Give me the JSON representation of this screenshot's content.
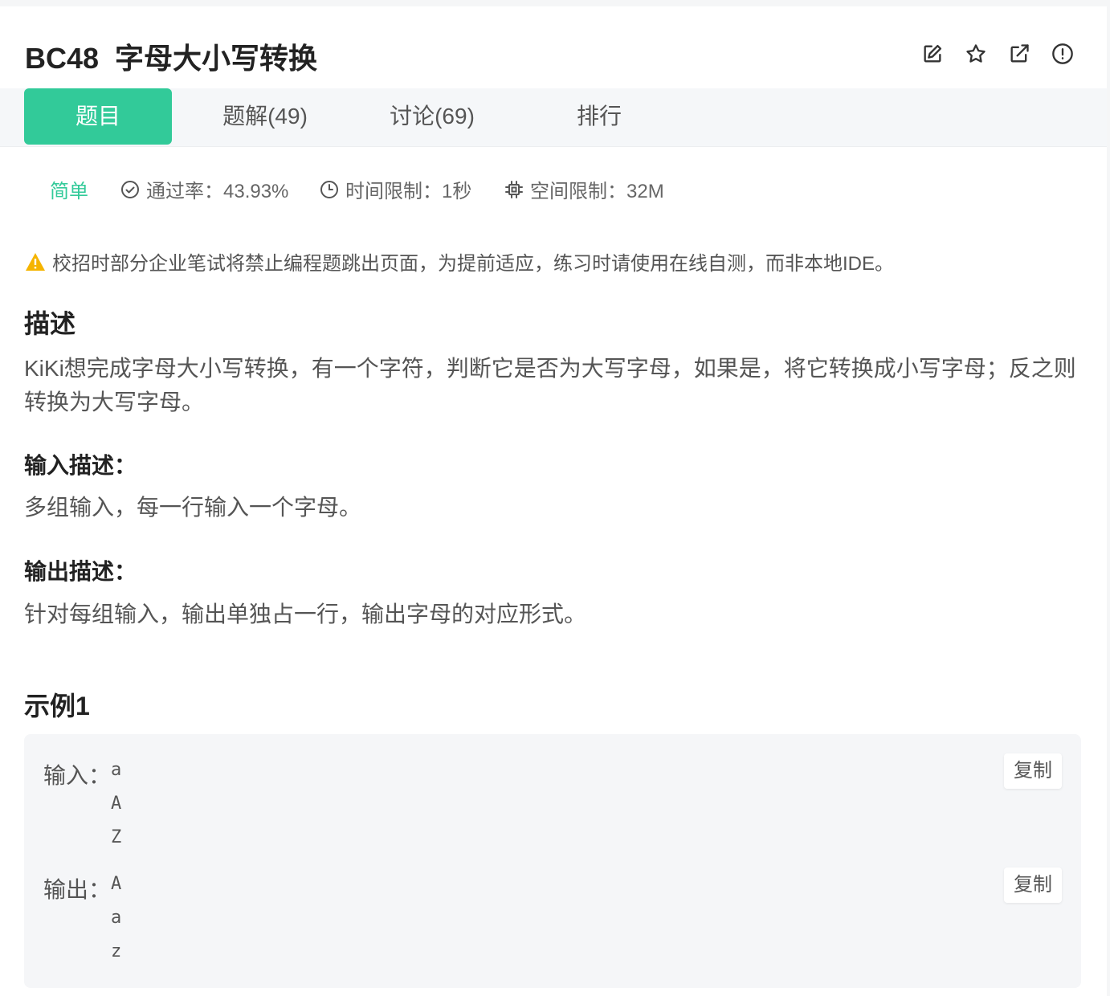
{
  "problem": {
    "id": "BC48",
    "title": "字母大小写转换"
  },
  "header_icons": [
    "edit-icon",
    "star-icon",
    "share-icon",
    "report-icon"
  ],
  "tabs": [
    {
      "label": "题目",
      "active": true
    },
    {
      "label": "题解(49)",
      "active": false
    },
    {
      "label": "讨论(69)",
      "active": false
    },
    {
      "label": "排行",
      "active": false
    }
  ],
  "meta": {
    "difficulty": "简单",
    "pass_rate": "通过率：43.93%",
    "time_limit": "时间限制：1秒",
    "memory_limit": "空间限制：32M"
  },
  "notice": "校招时部分企业笔试将禁止编程题跳出页面，为提前适应，练习时请使用在线自测，而非本地IDE。",
  "description": {
    "heading": "描述",
    "text": "KiKi想完成字母大小写转换，有一个字符，判断它是否为大写字母，如果是，将它转换成小写字母；反之则转换为大写字母。"
  },
  "input_desc": {
    "heading": "输入描述：",
    "text": "多组输入，每一行输入一个字母。"
  },
  "output_desc": {
    "heading": "输出描述：",
    "text": "针对每组输入，输出单独占一行，输出字母的对应形式。"
  },
  "example": {
    "heading": "示例1",
    "input_label": "输入：",
    "input_lines": [
      "a",
      "A",
      "Z"
    ],
    "output_label": "输出：",
    "output_lines": [
      "A",
      "a",
      "z"
    ],
    "copy_label": "复制"
  },
  "colors": {
    "accent": "#32ca99",
    "warning": "#f5b400"
  }
}
